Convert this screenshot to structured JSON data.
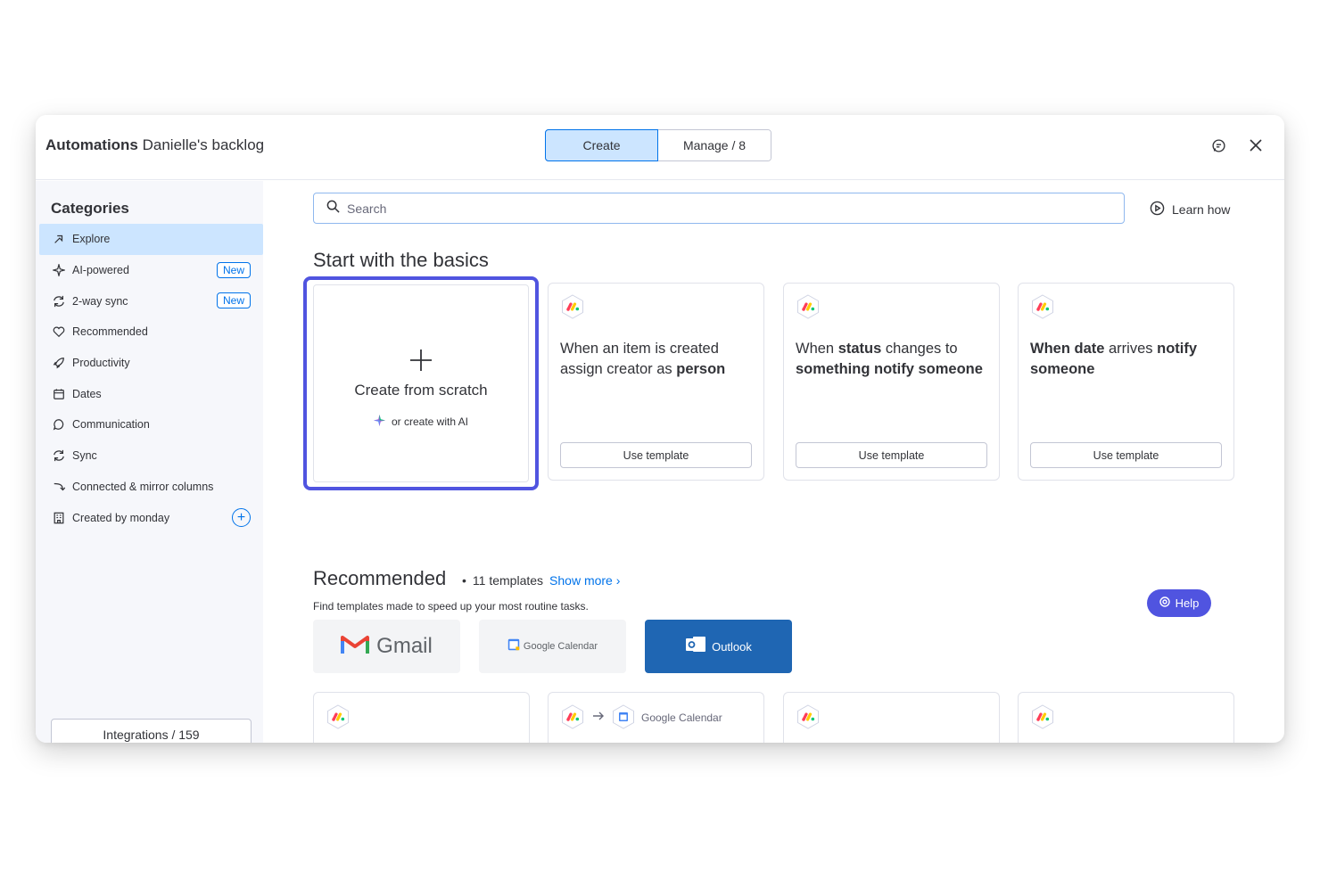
{
  "header": {
    "app_title": "Automations",
    "board_name": "Danielle's backlog",
    "tabs": [
      {
        "label": "Create",
        "active": true
      },
      {
        "label": "Manage / 8",
        "active": false
      }
    ],
    "feedback_icon": "chat-bubble-icon",
    "close_icon": "close-icon"
  },
  "sidebar": {
    "title": "Categories",
    "items": [
      {
        "label": "Explore",
        "icon": "compass-icon",
        "active": true
      },
      {
        "label": "AI-powered",
        "icon": "sparkle-icon",
        "badge": "New"
      },
      {
        "label": "2-way sync",
        "icon": "sync-icon",
        "badge": "New"
      },
      {
        "label": "Recommended",
        "icon": "heart-icon"
      },
      {
        "label": "Productivity",
        "icon": "rocket-icon"
      },
      {
        "label": "Dates",
        "icon": "calendar-icon"
      },
      {
        "label": "Communication",
        "icon": "chat-icon"
      },
      {
        "label": "Sync",
        "icon": "sync-icon"
      },
      {
        "label": "Connected & mirror columns",
        "icon": "connect-icon"
      },
      {
        "label": "Created by monday",
        "icon": "building-icon"
      }
    ],
    "integrations_label": "Integrations / 159",
    "integration_icons": [
      "outlook-icon",
      "gmail-icon",
      "slack-icon",
      "google-calendar-icon"
    ]
  },
  "main": {
    "search_placeholder": "Search",
    "learn_how": "Learn how",
    "basics_title": "Start with the basics",
    "scratch": {
      "label": "Create from scratch",
      "ai_label": "or create with AI"
    },
    "templates": [
      {
        "parts": [
          [
            "When an item is created assign creator as ",
            false
          ],
          [
            "person",
            true
          ]
        ],
        "button": "Use template"
      },
      {
        "parts": [
          [
            "When ",
            false
          ],
          [
            "status",
            true
          ],
          [
            " changes to ",
            false
          ],
          [
            "something notify someone",
            true
          ]
        ],
        "button": "Use template"
      },
      {
        "parts": [
          [
            "When date",
            true
          ],
          [
            " arrives ",
            false
          ],
          [
            "notify someone",
            true
          ]
        ],
        "button": "Use template"
      }
    ],
    "recommended": {
      "title": "Recommended",
      "count": "11 templates",
      "show_more": "Show more",
      "subtitle": "Find templates made to speed up your most routine tasks.",
      "tiles": [
        {
          "label": "Gmail",
          "icon": "gmail-icon"
        },
        {
          "label": "Google Calendar",
          "icon": "google-calendar-icon"
        },
        {
          "label": "Outlook",
          "icon": "outlook-icon"
        }
      ],
      "card2_label": "Google Calendar"
    },
    "help_label": "Help"
  },
  "colors": {
    "accent": "#0073ea",
    "selected": "#cce5ff",
    "highlight": "#5054e0",
    "outlook": "#1f66b3"
  }
}
